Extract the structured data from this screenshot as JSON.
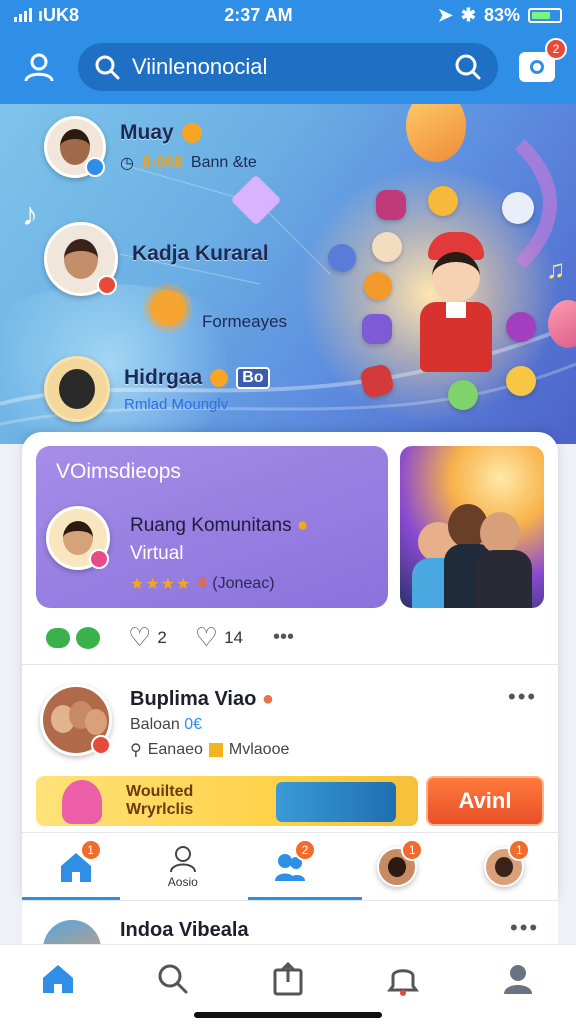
{
  "status_bar": {
    "carrier": "ıUK8",
    "time": "2:37 AM",
    "battery": "83%"
  },
  "header": {
    "search_text": "Viinlenonocial",
    "notification_count": "2"
  },
  "hero": {
    "people": [
      {
        "name": "Muay",
        "stat_value": "8:068",
        "stat_text": "Bann &te"
      },
      {
        "name": "Kadja Kuraral",
        "tag": "Formeayes"
      },
      {
        "name": "Hidrgaa",
        "badge": "Bo",
        "subtitle": "Rmlad Mounglv"
      }
    ]
  },
  "community": {
    "title": "VOimsdieops",
    "name": "Ruang Komunitans",
    "name_line2": "Virtual",
    "stars": "★★★★",
    "rating": "4",
    "rating_note": "(Joneac)"
  },
  "actions": {
    "like_count": "2",
    "heart_count": "14",
    "more": "•••"
  },
  "post": {
    "name": "Buplima Viao",
    "line2": "Baloan",
    "line2_tag": "0€",
    "line3": "Eanaeo",
    "line3_tag": "Mvlaooe",
    "more": "•••"
  },
  "banner": {
    "text_line1": "Wouilted",
    "text_line2": "Wryrlclis",
    "cta": "Avinl"
  },
  "story_bar": [
    {
      "label": "",
      "count": "1"
    },
    {
      "label": "Aosio",
      "count": ""
    },
    {
      "label": "",
      "count": "2"
    },
    {
      "label": "",
      "count": "1"
    },
    {
      "label": "",
      "count": "1"
    }
  ],
  "next_post": {
    "name": "Indoa Vibeala",
    "more": "•••"
  },
  "colors": {
    "primary": "#2f8fe6",
    "accent": "#f36b2a",
    "badge": "#e84a3a"
  }
}
